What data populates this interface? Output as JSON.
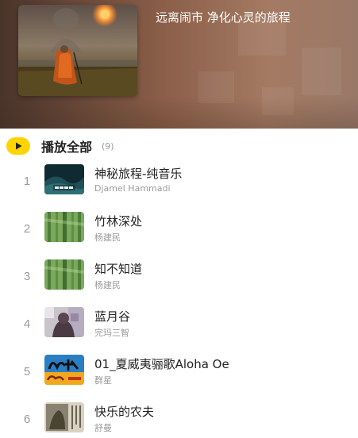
{
  "header": {
    "title": "远离闹市  净化心灵的旅程"
  },
  "playlist": {
    "play_all_label": "播放全部",
    "count": "(9)",
    "accent_color": "#ffd400",
    "tracks": [
      {
        "index": "1",
        "title": "神秘旅程-纯音乐",
        "artist": "Djamel Hammadi",
        "art": "dark-teal-cover"
      },
      {
        "index": "2",
        "title": "竹林深处",
        "artist": "杨建民",
        "art": "bamboo-cover"
      },
      {
        "index": "3",
        "title": "知不知道",
        "artist": "杨建民",
        "art": "bamboo-cover"
      },
      {
        "index": "4",
        "title": "蓝月谷",
        "artist": "完玛三智",
        "art": "portrait-cover"
      },
      {
        "index": "5",
        "title": "01_夏威夷骊歌Aloha Oe",
        "artist": "群星",
        "art": "calligraphy-cover"
      },
      {
        "index": "6",
        "title": "快乐的农夫",
        "artist": "舒曼",
        "art": "sketch-cover"
      }
    ]
  }
}
